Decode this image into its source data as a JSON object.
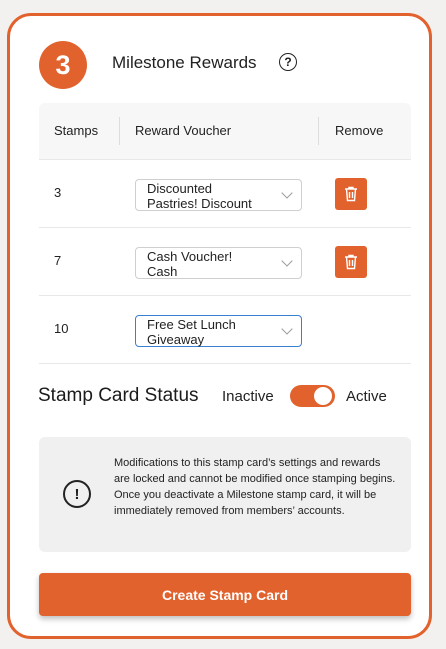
{
  "section": {
    "step_number": "3",
    "title": "Milestone Rewards",
    "help_icon": "question-circle-icon"
  },
  "table": {
    "headers": {
      "stamps": "Stamps",
      "reward": "Reward Voucher",
      "remove": "Remove"
    },
    "rows": [
      {
        "stamps": "3",
        "reward_line1": "Discounted",
        "reward_line2": "Pastries! Discount",
        "removable": true
      },
      {
        "stamps": "7",
        "reward_line1": "Cash Voucher!",
        "reward_line2": "Cash",
        "removable": true
      },
      {
        "stamps": "10",
        "reward_line1": "Free Set Lunch",
        "reward_line2": "Giveaway",
        "removable": false
      }
    ]
  },
  "status": {
    "title": "Stamp Card Status",
    "inactive_label": "Inactive",
    "active_label": "Active",
    "is_active": true
  },
  "notice": {
    "icon": "exclamation-circle-icon",
    "text": "Modifications to this stamp card’s settings and rewards are locked and cannot be modified once stamping begins. Once you deactivate a Milestone stamp card, it will be immediately removed from members’ accounts."
  },
  "create_button_label": "Create Stamp Card",
  "colors": {
    "accent": "#e2622d",
    "focus": "#3b7fd0"
  }
}
